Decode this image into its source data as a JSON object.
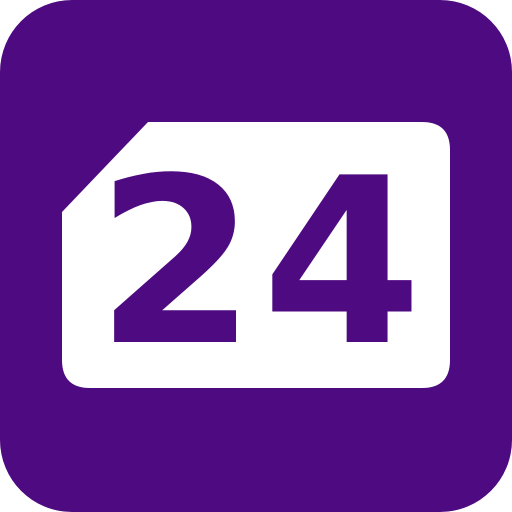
{
  "icon": {
    "name": "24-badge-icon",
    "label": "24",
    "colors": {
      "background": "#4e0a80",
      "badge": "#ffffff",
      "text": "#4e0a80"
    }
  }
}
